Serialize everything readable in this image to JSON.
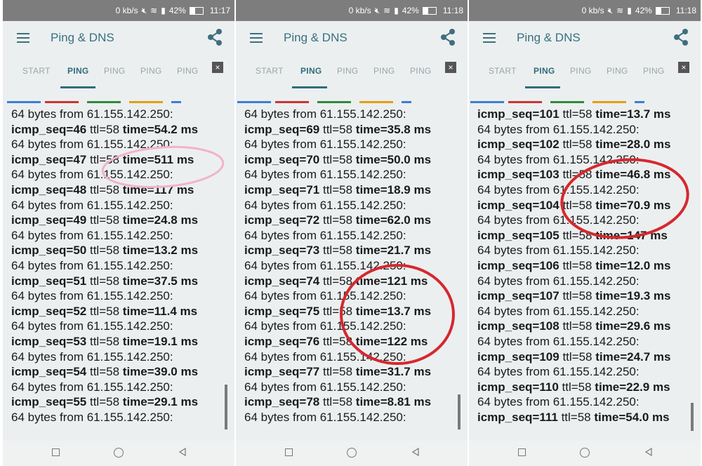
{
  "status": {
    "speed": "0 kb/s",
    "battery": "42%"
  },
  "app": {
    "title": "Ping & DNS",
    "tabs": [
      "START",
      "PING",
      "PING",
      "PING",
      "PING"
    ],
    "active_tab": 1,
    "close": "×"
  },
  "colors": {
    "accent": "#2f6c7b",
    "bar_colors": [
      "#3a7fd6",
      "#cc3333",
      "#2f8a3a",
      "#e0a010",
      "#3a7fd6"
    ],
    "annotation_red": "#d6282e",
    "annotation_pink": "#f2b3c9"
  },
  "panels": [
    {
      "time": "11:17",
      "lines": [
        {
          "plain": "64 bytes from 61.155.142.250:"
        },
        {
          "seq": "icmp_seq=46",
          "ttl": " ttl=58 ",
          "t": "time=54.2 ms"
        },
        {
          "plain": "64 bytes from 61.155.142.250:"
        },
        {
          "seq": "icmp_seq=47",
          "ttl": " ttl=58 ",
          "t": "time=511 ms"
        },
        {
          "plain": "64 bytes from 61.155.142.250:"
        },
        {
          "seq": "icmp_seq=48",
          "ttl": " ttl=58 ",
          "t": "time=117 ms"
        },
        {
          "plain": "64 bytes from 61.155.142.250:"
        },
        {
          "seq": "icmp_seq=49",
          "ttl": " ttl=58 ",
          "t": "time=24.8 ms"
        },
        {
          "plain": "64 bytes from 61.155.142.250:"
        },
        {
          "seq": "icmp_seq=50",
          "ttl": " ttl=58 ",
          "t": "time=13.2 ms"
        },
        {
          "plain": "64 bytes from 61.155.142.250:"
        },
        {
          "seq": "icmp_seq=51",
          "ttl": " ttl=58 ",
          "t": "time=37.5 ms"
        },
        {
          "plain": "64 bytes from 61.155.142.250:"
        },
        {
          "seq": "icmp_seq=52",
          "ttl": " ttl=58 ",
          "t": "time=11.4 ms"
        },
        {
          "plain": "64 bytes from 61.155.142.250:"
        },
        {
          "seq": "icmp_seq=53",
          "ttl": " ttl=58 ",
          "t": "time=19.1 ms"
        },
        {
          "plain": "64 bytes from 61.155.142.250:"
        },
        {
          "seq": "icmp_seq=54",
          "ttl": " ttl=58 ",
          "t": "time=39.0 ms"
        },
        {
          "plain": "64 bytes from 61.155.142.250:"
        },
        {
          "seq": "icmp_seq=55",
          "ttl": " ttl=58 ",
          "t": "time=29.1 ms"
        },
        {
          "plain": "64 bytes from 61.155.142.250:"
        }
      ]
    },
    {
      "time": "11:18",
      "lines": [
        {
          "plain": "64 bytes from 61.155.142.250:"
        },
        {
          "seq": "icmp_seq=69",
          "ttl": " ttl=58 ",
          "t": "time=35.8 ms"
        },
        {
          "plain": "64 bytes from 61.155.142.250:"
        },
        {
          "seq": "icmp_seq=70",
          "ttl": " ttl=58 ",
          "t": "time=50.0 ms"
        },
        {
          "plain": "64 bytes from 61.155.142.250:"
        },
        {
          "seq": "icmp_seq=71",
          "ttl": " ttl=58 ",
          "t": "time=18.9 ms"
        },
        {
          "plain": "64 bytes from 61.155.142.250:"
        },
        {
          "seq": "icmp_seq=72",
          "ttl": " ttl=58 ",
          "t": "time=62.0 ms"
        },
        {
          "plain": "64 bytes from 61.155.142.250:"
        },
        {
          "seq": "icmp_seq=73",
          "ttl": " ttl=58 ",
          "t": "time=21.7 ms"
        },
        {
          "plain": "64 bytes from 61.155.142.250:"
        },
        {
          "seq": "icmp_seq=74",
          "ttl": " ttl=58 ",
          "t": "time=121 ms"
        },
        {
          "plain": "64 bytes from 61.155.142.250:"
        },
        {
          "seq": "icmp_seq=75",
          "ttl": " ttl=58 ",
          "t": "time=13.7 ms"
        },
        {
          "plain": "64 bytes from 61.155.142.250:"
        },
        {
          "seq": "icmp_seq=76",
          "ttl": " ttl=58 ",
          "t": "time=122 ms"
        },
        {
          "plain": "64 bytes from 61.155.142.250:"
        },
        {
          "seq": "icmp_seq=77",
          "ttl": " ttl=58 ",
          "t": "time=31.7 ms"
        },
        {
          "plain": "64 bytes from 61.155.142.250:"
        },
        {
          "seq": "icmp_seq=78",
          "ttl": " ttl=58 ",
          "t": "time=8.81 ms"
        },
        {
          "plain": "64 bytes from 61.155.142.250:"
        }
      ]
    },
    {
      "time": "11:18",
      "lines": [
        {
          "seq": "icmp_seq=101",
          "ttl": " ttl=58 ",
          "t": "time=13.7 ms"
        },
        {
          "plain": "64 bytes from 61.155.142.250:"
        },
        {
          "seq": "icmp_seq=102",
          "ttl": " ttl=58 ",
          "t": "time=28.0 ms"
        },
        {
          "plain": "64 bytes from 61.155.142.250:"
        },
        {
          "seq": "icmp_seq=103",
          "ttl": " ttl=58 ",
          "t": "time=46.8 ms"
        },
        {
          "plain": "64 bytes from 61.155.142.250:"
        },
        {
          "seq": "icmp_seq=104",
          "ttl": " ttl=58 ",
          "t": "time=70.9 ms"
        },
        {
          "plain": "64 bytes from 61.155.142.250:"
        },
        {
          "seq": "icmp_seq=105",
          "ttl": " ttl=58 ",
          "t": "time=147 ms"
        },
        {
          "plain": "64 bytes from 61.155.142.250:"
        },
        {
          "seq": "icmp_seq=106",
          "ttl": " ttl=58 ",
          "t": "time=12.0 ms"
        },
        {
          "plain": "64 bytes from 61.155.142.250:"
        },
        {
          "seq": "icmp_seq=107",
          "ttl": " ttl=58 ",
          "t": "time=19.3 ms"
        },
        {
          "plain": "64 bytes from 61.155.142.250:"
        },
        {
          "seq": "icmp_seq=108",
          "ttl": " ttl=58 ",
          "t": "time=29.6 ms"
        },
        {
          "plain": "64 bytes from 61.155.142.250:"
        },
        {
          "seq": "icmp_seq=109",
          "ttl": " ttl=58 ",
          "t": "time=24.7 ms"
        },
        {
          "plain": "64 bytes from 61.155.142.250:"
        },
        {
          "seq": "icmp_seq=110",
          "ttl": " ttl=58 ",
          "t": "time=22.9 ms"
        },
        {
          "plain": "64 bytes from 61.155.142.250:"
        },
        {
          "seq": "icmp_seq=111",
          "ttl": " ttl=58 ",
          "t": "time=54.0 ms"
        }
      ]
    }
  ]
}
